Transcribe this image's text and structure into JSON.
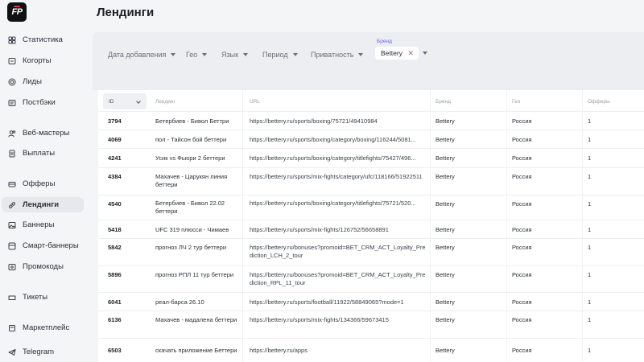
{
  "app": {
    "logo_text": "FP",
    "title": "Лендинги"
  },
  "sidebar": {
    "items": [
      {
        "label": "Статистика",
        "icon": "grid-icon"
      },
      {
        "label": "Когорты",
        "icon": "cohort-icon"
      },
      {
        "label": "Лиды",
        "icon": "target-icon"
      },
      {
        "label": "Постбэки",
        "icon": "postback-icon"
      },
      {
        "label": "Веб-мастеры",
        "icon": "users-icon"
      },
      {
        "label": "Выплаты",
        "icon": "document-icon"
      },
      {
        "label": "Офферы",
        "icon": "offer-icon"
      },
      {
        "label": "Лендинги",
        "icon": "link-icon",
        "active": true
      },
      {
        "label": "Баннеры",
        "icon": "image-icon"
      },
      {
        "label": "Смарт-баннеры",
        "icon": "smart-banner-icon"
      },
      {
        "label": "Промокоды",
        "icon": "promo-icon"
      },
      {
        "label": "Тикеты",
        "icon": "ticket-icon"
      },
      {
        "label": "Маркетплейс",
        "icon": "cart-icon"
      },
      {
        "label": "Telegram",
        "icon": "telegram-icon"
      }
    ]
  },
  "filters": {
    "date_added": "Дата добавления",
    "geo": "Гео",
    "language": "Язык",
    "period": "Период",
    "privacy": "Приватность",
    "brand_label": "Бренд",
    "brand_value": "Bettery",
    "brand_clear": "✕"
  },
  "table": {
    "headers": {
      "id": "ID",
      "name": "Лендинг",
      "url": "URL",
      "brand": "Бренд",
      "geo": "Гео",
      "offers": "Офферы"
    },
    "rows": [
      {
        "id": "3794",
        "name": "Бетербиев - Бивол Беттри",
        "url": "https://bettery.ru/sports/boxing/75721/49410984",
        "brand": "Bettery",
        "geo": "Россия",
        "offers": "1"
      },
      {
        "id": "4069",
        "name": "пол - Тайсон бой беттери",
        "url": "https://bettery.ru/sports/boxing/category/boxing/116244/5081...",
        "brand": "Bettery",
        "geo": "Россия",
        "offers": "1"
      },
      {
        "id": "4241",
        "name": "Усик vs Фьюри 2 беттери",
        "url": "https://bettery.ru/sports/boxing/category/titlefights/75427/496...",
        "brand": "Bettery",
        "geo": "Россия",
        "offers": "1"
      },
      {
        "id": "4384",
        "name": "Махачев - Царукян линия беттери",
        "url": "https://bettery.ru/sports/mix-fights/category/ufc/118166/51922511",
        "brand": "Bettery",
        "geo": "Россия",
        "offers": "1"
      },
      {
        "id": "4540",
        "name": "Бетербиев - Бивол 22.02 беттери",
        "url": "https://bettery.ru/sports/boxing/category/titlefights/75721/520...",
        "brand": "Bettery",
        "geo": "Россия",
        "offers": "1"
      },
      {
        "id": "5418",
        "name": "UFC 319 плюсси - Чимаев",
        "url": "https://bettery.ru/sports/mix-fights/126752/56658891",
        "brand": "Bettery",
        "geo": "Россия",
        "offers": "1"
      },
      {
        "id": "5842",
        "name": "прогноз ЛЧ 2 тур беттери",
        "url": "https://bettery.ru/bonuses?promoid=BET_CRM_ACT_Loyalty_Prediction_LCH_2_tour",
        "brand": "Bettery",
        "geo": "Россия",
        "offers": "1"
      },
      {
        "id": "5896",
        "name": "прогноз РПЛ 11 тур беттери",
        "url": "https://bettery.ru/bonuses?promoid=BET_CRM_ACT_Loyalty_Prediction_RPL_11_tour",
        "brand": "Bettery",
        "geo": "Россия",
        "offers": "1"
      },
      {
        "id": "6041",
        "name": "реал-барса 26.10",
        "url": "https://bettery.ru/sports/football/11922/58849065?mode=1",
        "brand": "Bettery",
        "geo": "Россия",
        "offers": "1"
      },
      {
        "id": "6136",
        "name": "Махачев - мадалена беттери",
        "url": "https://bettery.ru/sports/mix-fights/134366/59673415",
        "brand": "Bettery",
        "geo": "Россия",
        "offers": "1"
      },
      {
        "id": "6503",
        "name": "скачать приложение Беттери",
        "url": "https://bettery.ru/apps",
        "brand": "Bettery",
        "geo": "Россия",
        "offers": "1"
      }
    ]
  }
}
